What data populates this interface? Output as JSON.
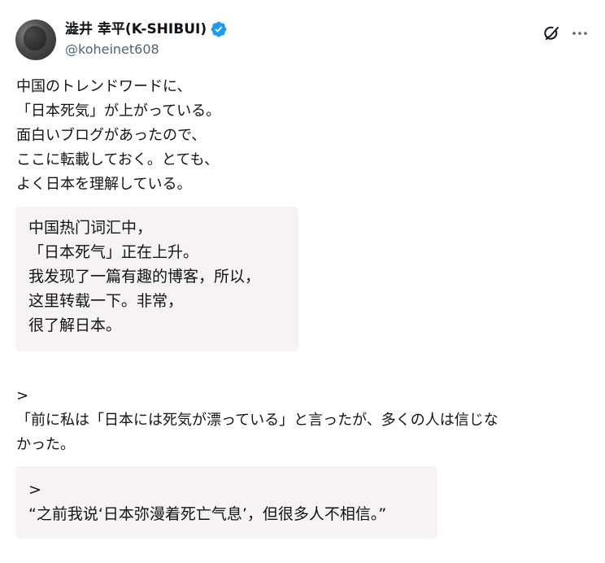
{
  "author": {
    "display_name": "澁井 幸平(K-SHIBUI)",
    "handle": "@koheinet608",
    "verified": true,
    "avatar_icon": "avatar-photo"
  },
  "header_actions": {
    "grok_icon": "grok-icon",
    "more_icon": "more-icon"
  },
  "post": {
    "paragraph1": "中国のトレンドワードに、\n「日本死気」が上がっている。\n面白いブログがあったので、\nここに転載しておく。とても、\nよく日本を理解している。",
    "quote1": "中国热门词汇中，\n「日本死气」正在上升。\n我发现了一篇有趣的博客，所以，\n这里转载一下。非常，\n很了解日本。",
    "paragraph2": ">\n「前に私は「日本には死気が漂っている」と言ったが、多くの人は信じな\nかった。",
    "quote2": ">\n“之前我说‘日本弥漫着死亡气息’，但很多人不相信。”"
  },
  "colors": {
    "verified_badge": "#1d9bf0",
    "quote_background": "#f7f3f3",
    "text_primary": "#0f1419",
    "text_secondary": "#536471"
  }
}
